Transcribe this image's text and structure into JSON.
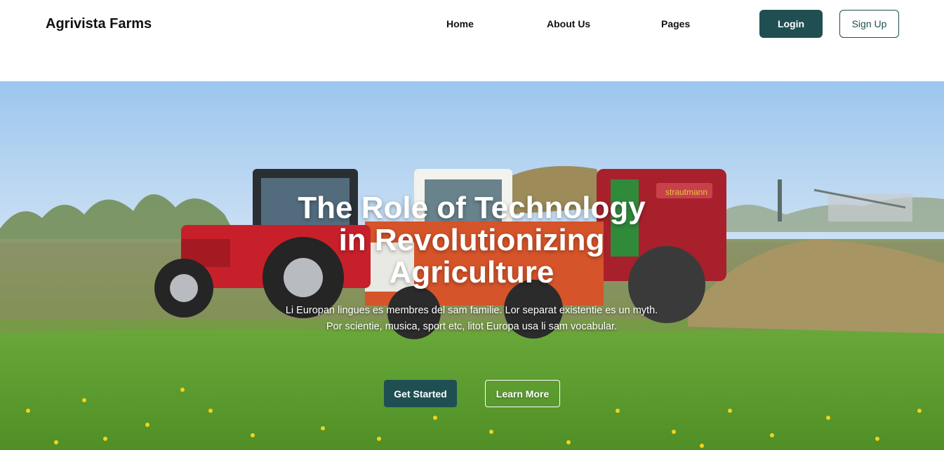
{
  "header": {
    "brand": "Agrivista Farms",
    "nav": [
      {
        "label": "Home"
      },
      {
        "label": "About Us"
      },
      {
        "label": "Pages"
      }
    ],
    "login_label": "Login",
    "signup_label": "Sign Up"
  },
  "hero": {
    "title_lines": [
      "The Role of Technology",
      "in Revolutionizing",
      "Agriculture"
    ],
    "subtitle": "Li Europan lingues es membres del sam familie. Lor separat existentie es un myth. Por scientie, musica, sport etc, litot Europa usa li sam vocabular.",
    "get_started_label": "Get Started",
    "learn_more_label": "Learn More",
    "image_description_icon": "tractors-field-image",
    "baler_brand_text": "strautmann"
  },
  "colors": {
    "primary": "#1f4f52",
    "text_dark": "#111111",
    "sky": "#a9cdee",
    "grass": "#5f9b2f",
    "tractor_red": "#c8202a"
  }
}
